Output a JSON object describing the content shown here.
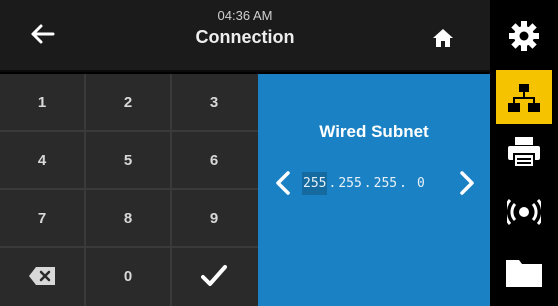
{
  "header": {
    "time": "04:36 AM",
    "title": "Connection",
    "back_icon": "arrow-left-icon",
    "home_icon": "home-icon"
  },
  "sidebar": {
    "items": [
      {
        "name": "settings",
        "icon": "gear-icon",
        "active": false
      },
      {
        "name": "network",
        "icon": "network-icon",
        "active": true
      },
      {
        "name": "print",
        "icon": "printer-icon",
        "active": false
      },
      {
        "name": "wireless",
        "icon": "antenna-icon",
        "active": false
      },
      {
        "name": "storage",
        "icon": "folder-icon",
        "active": false
      }
    ]
  },
  "keypad": {
    "keys": [
      "1",
      "2",
      "3",
      "4",
      "5",
      "6",
      "7",
      "8",
      "9",
      "",
      "0",
      ""
    ],
    "backspace_icon": "backspace-icon",
    "confirm_icon": "checkmark-icon"
  },
  "panel": {
    "title": "Wired Subnet",
    "segments": [
      "255",
      "255",
      "255",
      "0"
    ],
    "separator": ".",
    "active_segment": 0,
    "left_icon": "chevron-left-icon",
    "right_icon": "chevron-right-icon"
  },
  "colors": {
    "accent": "#f6c300",
    "panel": "#1a82c4",
    "keypad": "#2a2a2a"
  }
}
